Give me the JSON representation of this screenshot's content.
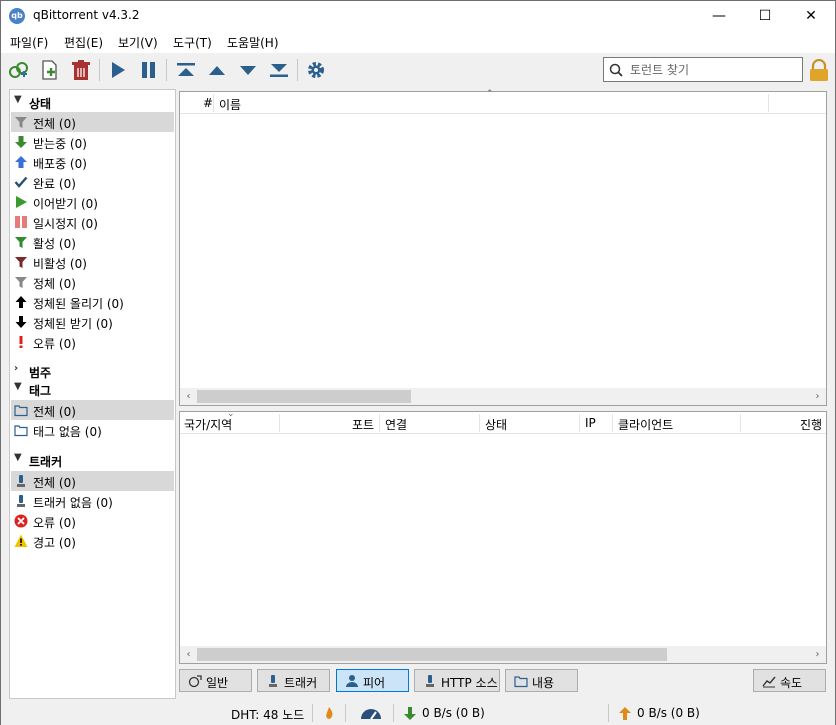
{
  "window": {
    "title": "qBittorrent v4.3.2",
    "app_icon_text": "qb",
    "minimize": "—",
    "maximize": "☐",
    "close": "✕"
  },
  "menu": [
    "파일(F)",
    "편집(E)",
    "보기(V)",
    "도구(T)",
    "도움말(H)"
  ],
  "search": {
    "placeholder": "토런트 찾기"
  },
  "sidebar": {
    "status_header": "상태",
    "status_items": [
      {
        "label": "전체 (0)",
        "icon": "filter-icon"
      },
      {
        "label": "받는중 (0)",
        "icon": "download-arrow-icon"
      },
      {
        "label": "배포중 (0)",
        "icon": "upload-arrow-icon"
      },
      {
        "label": "완료 (0)",
        "icon": "checkmark-icon"
      },
      {
        "label": "이어받기 (0)",
        "icon": "play-icon"
      },
      {
        "label": "일시정지 (0)",
        "icon": "pause-icon"
      },
      {
        "label": "활성 (0)",
        "icon": "green-filter-icon"
      },
      {
        "label": "비활성 (0)",
        "icon": "red-filter-icon"
      },
      {
        "label": "정체 (0)",
        "icon": "gray-filter-icon"
      },
      {
        "label": "정체된 올리기 (0)",
        "icon": "black-up-arrow-icon"
      },
      {
        "label": "정체된 받기 (0)",
        "icon": "black-down-arrow-icon"
      },
      {
        "label": "오류 (0)",
        "icon": "exclamation-icon"
      }
    ],
    "category_header": "범주",
    "tag_header": "태그",
    "tag_items": [
      {
        "label": "전체 (0)",
        "icon": "folder-icon"
      },
      {
        "label": "태그 없음 (0)",
        "icon": "folder-icon"
      }
    ],
    "tracker_header": "트래커",
    "tracker_items": [
      {
        "label": "전체 (0)",
        "icon": "tracker-icon"
      },
      {
        "label": "트래커 없음 (0)",
        "icon": "tracker-icon"
      },
      {
        "label": "오류 (0)",
        "icon": "error-circle-icon"
      },
      {
        "label": "경고 (0)",
        "icon": "warning-icon"
      }
    ]
  },
  "torrent_list": {
    "columns": [
      "#",
      "이름"
    ]
  },
  "peer_list": {
    "columns": [
      "국가/지역",
      "포트",
      "연결",
      "상태",
      "IP",
      "클라이언트",
      "진행"
    ]
  },
  "tabs": [
    {
      "label": "일반",
      "icon": "info-icon"
    },
    {
      "label": "트래커",
      "icon": "tracker-icon"
    },
    {
      "label": "피어",
      "icon": "peers-icon"
    },
    {
      "label": "HTTP 소스",
      "icon": "tracker-icon"
    },
    {
      "label": "내용",
      "icon": "folder-icon"
    }
  ],
  "speed_button": "속도",
  "status": {
    "dht": "DHT: 48 노드",
    "download_speed": "0 B/s (0 B)",
    "upload_speed": "0 B/s (0 B)"
  },
  "colors": {
    "accent": "#2b6ca3",
    "selection": "#d8d8d8",
    "download": "#3a8a2e",
    "upload": "#3a6fd8",
    "error": "#e02020"
  }
}
